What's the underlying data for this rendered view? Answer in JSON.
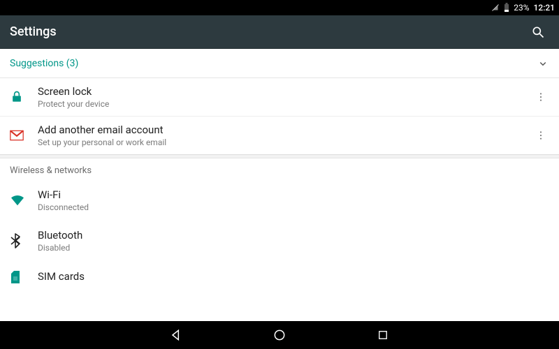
{
  "status": {
    "battery": "23%",
    "clock": "12:21"
  },
  "header": {
    "title": "Settings"
  },
  "suggestions": {
    "header": "Suggestions (3)",
    "items": [
      {
        "title": "Screen lock",
        "sub": "Protect your device"
      },
      {
        "title": "Add another email account",
        "sub": "Set up your personal or work email"
      }
    ]
  },
  "sections": {
    "wireless": {
      "label": "Wireless & networks",
      "items": [
        {
          "title": "Wi-Fi",
          "sub": "Disconnected"
        },
        {
          "title": "Bluetooth",
          "sub": "Disabled"
        },
        {
          "title": "SIM cards",
          "sub": ""
        }
      ]
    }
  },
  "colors": {
    "teal": "#009688",
    "gmailRed": "#d93025"
  }
}
